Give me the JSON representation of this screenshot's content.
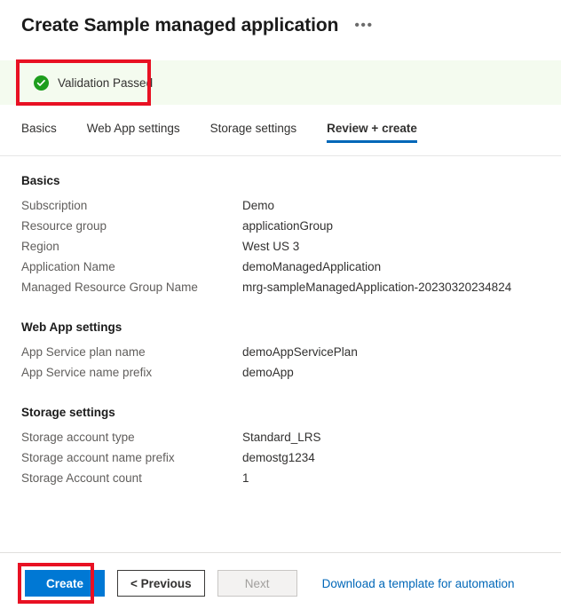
{
  "header": {
    "title": "Create Sample managed application",
    "overflow_menu_label": "•••"
  },
  "validation": {
    "text": "Validation Passed",
    "icon": "check-circle-icon",
    "status_color": "#1e9e1e",
    "banner_background": "#f4fbef",
    "annotation_color": "#e81123"
  },
  "tabs": [
    {
      "label": "Basics",
      "active": false
    },
    {
      "label": "Web App settings",
      "active": false
    },
    {
      "label": "Storage settings",
      "active": false
    },
    {
      "label": "Review + create",
      "active": true
    }
  ],
  "accent_color": "#0078d4",
  "tab_underline_color": "#0067b8",
  "sections": [
    {
      "title": "Basics",
      "rows": [
        {
          "label": "Subscription",
          "value": "Demo"
        },
        {
          "label": "Resource group",
          "value": "applicationGroup"
        },
        {
          "label": "Region",
          "value": "West US 3"
        },
        {
          "label": "Application Name",
          "value": "demoManagedApplication"
        },
        {
          "label": "Managed Resource Group Name",
          "value": "mrg-sampleManagedApplication-20230320234824"
        }
      ]
    },
    {
      "title": "Web App settings",
      "rows": [
        {
          "label": "App Service plan name",
          "value": "demoAppServicePlan"
        },
        {
          "label": "App Service name prefix",
          "value": "demoApp"
        }
      ]
    },
    {
      "title": "Storage settings",
      "rows": [
        {
          "label": "Storage account type",
          "value": "Standard_LRS"
        },
        {
          "label": "Storage account name prefix",
          "value": "demostg1234"
        },
        {
          "label": "Storage Account count",
          "value": "1"
        }
      ]
    }
  ],
  "footer": {
    "create_label": "Create",
    "previous_label": "< Previous",
    "next_label": "Next",
    "next_disabled": true,
    "download_template_label": "Download a template for automation"
  }
}
